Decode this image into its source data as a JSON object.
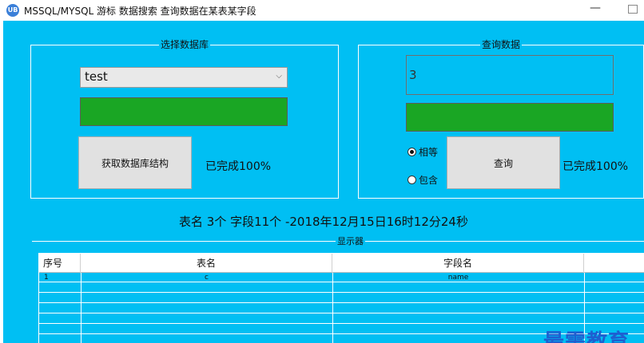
{
  "window": {
    "icon_text": "UB",
    "title": "MSSQL/MYSQL 游标 数据搜索 查询数据在某表某字段",
    "minimize_glyph": "—"
  },
  "db_group": {
    "legend": "选择数据库",
    "database_select": {
      "selected": "test",
      "chevron": "⌵"
    },
    "progress_fill": 1.0,
    "fetch_button": "获取数据库结构",
    "status": "已完成100%"
  },
  "query_group": {
    "legend": "查询数据",
    "query_value": "3",
    "progress_fill": 1.0,
    "radio_equal": {
      "label": "相等",
      "checked": true
    },
    "radio_contain": {
      "label": "包含",
      "checked": false
    },
    "query_button": "查询",
    "status": "已完成100%"
  },
  "summary": "表名  3个    字段11个  -2018年12月15日16时12分24秒",
  "display": {
    "legend": "显示器",
    "columns": [
      "序号",
      "表名",
      "字段名"
    ],
    "rows": [
      [
        "1",
        "c",
        "name"
      ]
    ]
  },
  "watermark": "最需教育",
  "colors": {
    "client_bg": "#00bff3",
    "progress_green": "#1aa624",
    "watermark": "#1e5fd0"
  }
}
